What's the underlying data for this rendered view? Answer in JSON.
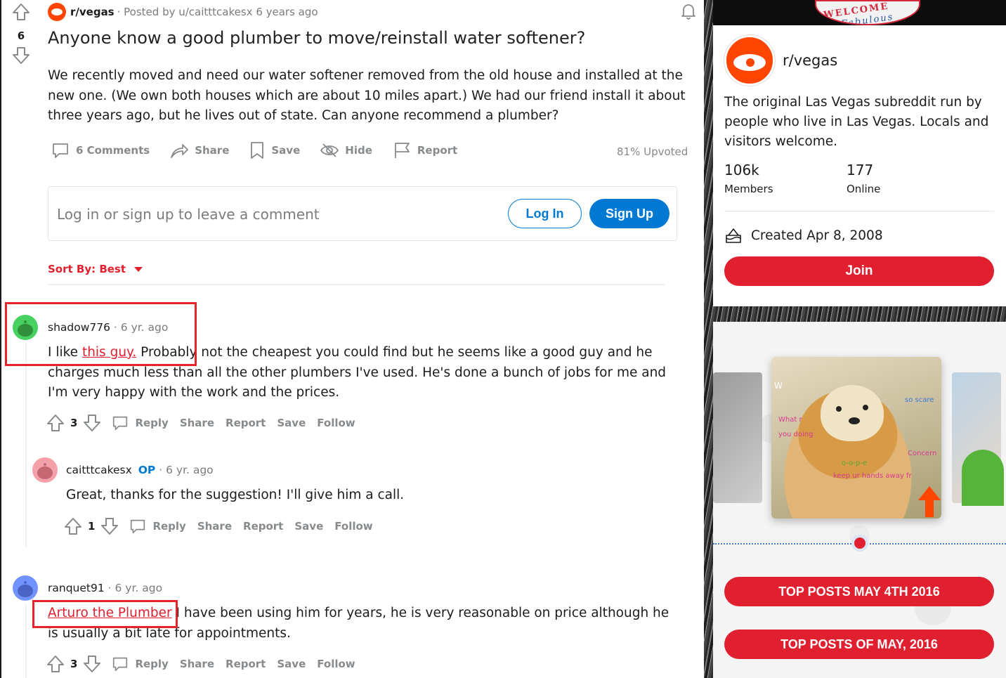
{
  "post": {
    "subreddit": "r/vegas",
    "posted_by": "· Posted by u/caitttcakesx 6 years ago",
    "votes": "6",
    "title": "Anyone know a good plumber to move/reinstall water softener?",
    "body": "We recently moved and need our water softener removed from the old house and installed at the new one. (We own both houses which are about 10 miles apart.) We had our friend install it about three years ago, but he lives out of state. Can anyone recommend a plumber?",
    "actions": {
      "comments": "6 Comments",
      "share": "Share",
      "save": "Save",
      "hide": "Hide",
      "report": "Report"
    },
    "upvoted": "81% Upvoted"
  },
  "login_box": {
    "prompt": "Log in or sign up to leave a comment",
    "login": "Log In",
    "signup": "Sign Up"
  },
  "sort": {
    "label": "Sort By: Best"
  },
  "comments": [
    {
      "author": "shadow776",
      "time": "· 6 yr. ago",
      "body_pre": "I like ",
      "link": "this guy.",
      "body_post": " Probably not the cheapest you could find but he seems like a good guy and he charges much less than all the other plumbers I've used. He's done a bunch of jobs for me and I'm very happy with the work and the prices.",
      "votes": "3"
    },
    {
      "author": "caitttcakesx",
      "op": "OP",
      "time": "· 6 yr. ago",
      "body": "Great, thanks for the suggestion! I'll give him a call.",
      "votes": "1"
    },
    {
      "author": "ranquet91",
      "time": "· 6 yr. ago",
      "link": "Arturo the Plumber",
      "body_post": " I have been using him for years, he is very reasonable on price although he is usually a bit late for appointments.",
      "votes": "3"
    }
  ],
  "comment_actions": {
    "reply": "Reply",
    "share": "Share",
    "report": "Report",
    "save": "Save",
    "follow": "Follow"
  },
  "sidebar": {
    "name": "r/vegas",
    "description": "The original Las Vegas subreddit run by people who live in Las Vegas. Locals and visitors welcome.",
    "members_count": "106k",
    "members_label": "Members",
    "online_count": "177",
    "online_label": "Online",
    "created": "Created Apr 8, 2008",
    "join": "Join"
  },
  "banner_sign": {
    "line1": "WELCOME",
    "line2": "Fabulous"
  },
  "promo": {
    "image_texts": {
      "t1": "W",
      "t2": "so scare",
      "t3": "What r",
      "t4": "you doing",
      "t5": "Concern",
      "t6": "o-o-p-e",
      "t7": "keep ur hands away fr"
    },
    "button1": "TOP POSTS MAY 4TH 2016",
    "button2": "TOP POSTS OF MAY, 2016"
  },
  "colors": {
    "brand_red": "#e0202e",
    "link_blue": "#0079d3",
    "reddit_orange": "#ff4500",
    "highlight": "#e4232b"
  }
}
